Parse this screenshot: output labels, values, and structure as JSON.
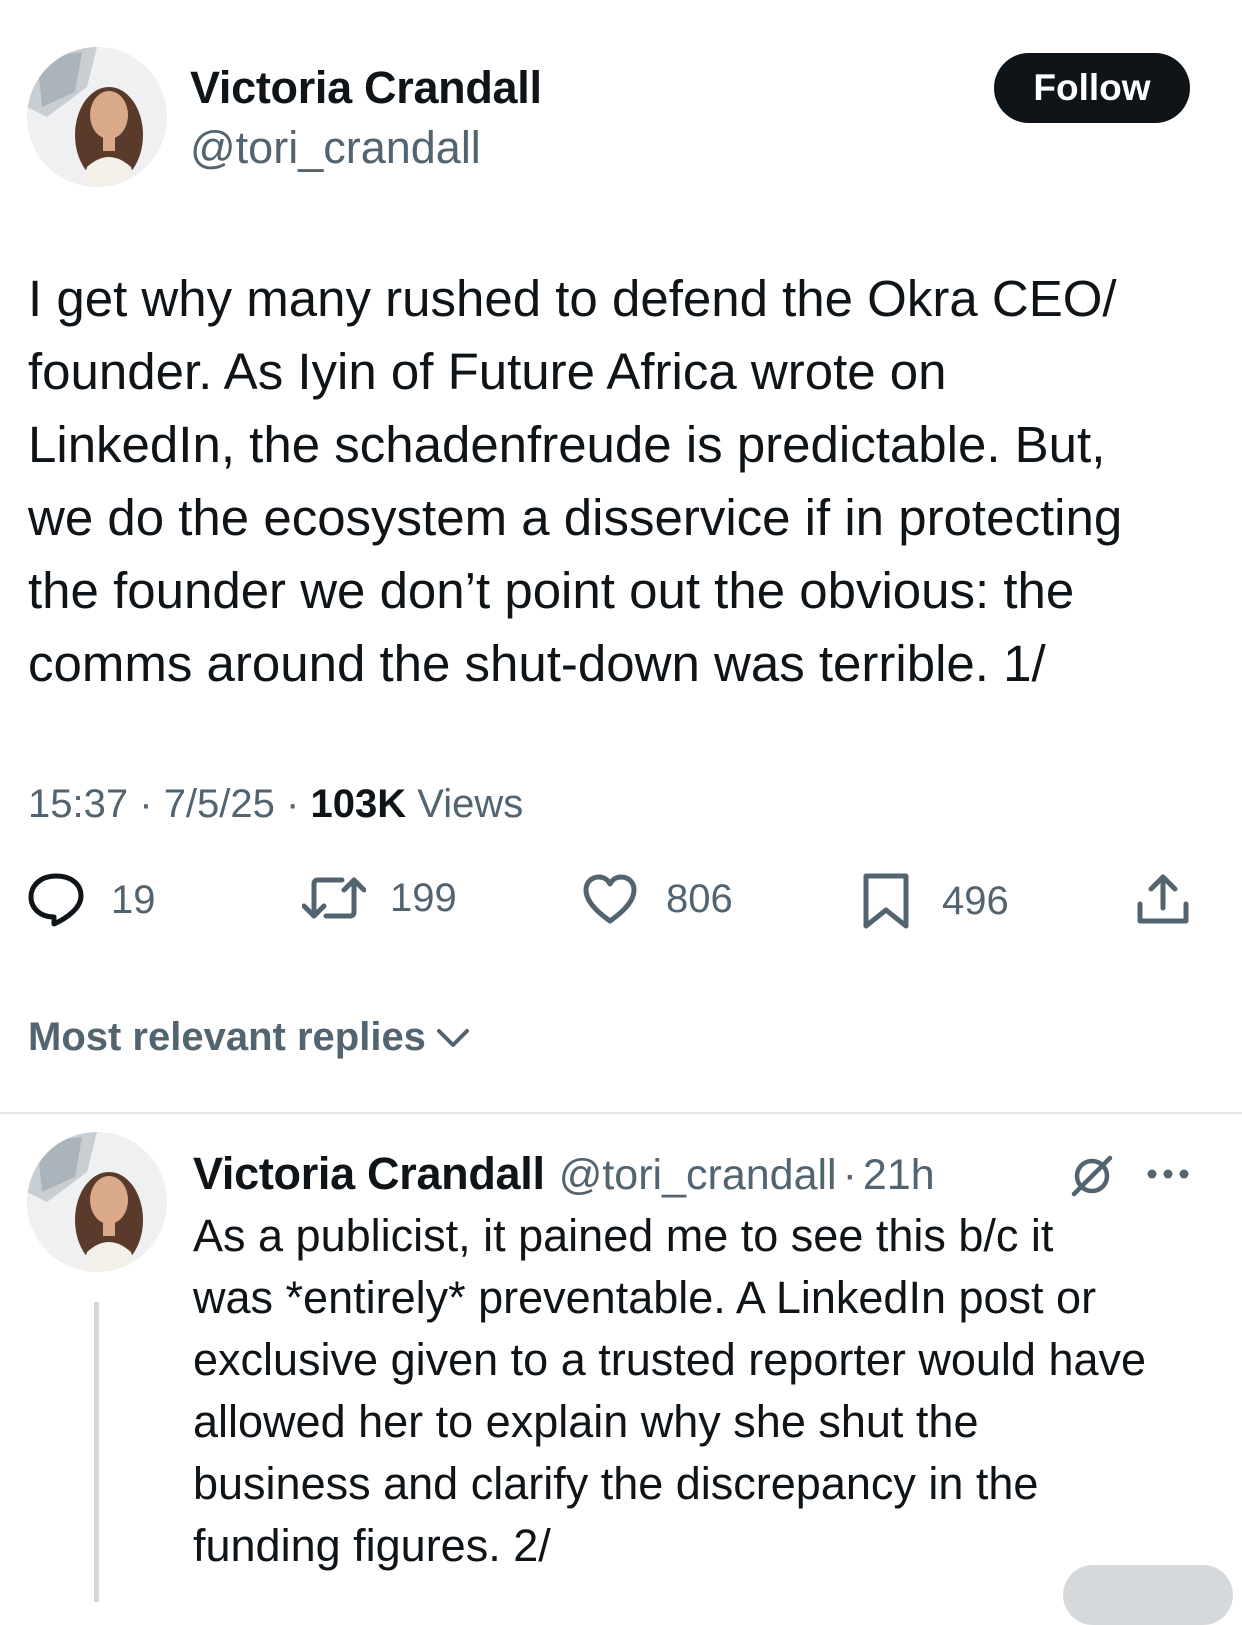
{
  "tweet": {
    "author": {
      "name": "Victoria Crandall",
      "handle": "@tori_crandall"
    },
    "follow_label": "Follow",
    "text": "I get why many rushed to defend the Okra CEO/\nfounder. As Iyin of Future Africa wrote on\nLinkedIn, the schadenfreude is predictable. But,\nwe do the ecosystem a disservice if in protecting\nthe founder we don’t point out the obvious: the\ncomms around the shut-down was terrible. 1/",
    "time": "15:37",
    "date": "7/5/25",
    "separator": "·",
    "views_count": "103K",
    "views_label": "Views",
    "stats": {
      "replies": "19",
      "reposts": "199",
      "likes": "806",
      "bookmarks": "496"
    }
  },
  "replies_sort": {
    "label": "Most relevant replies"
  },
  "reply": {
    "author": {
      "name": "Victoria Crandall",
      "handle": "@tori_crandall"
    },
    "separator": "·",
    "age": "21h",
    "text": "As a publicist, it pained me to see this b/c it\nwas *entirely* preventable. A LinkedIn post or\nexclusive given to a trusted reporter would have\nallowed her to explain why she shut the\nbusiness and clarify the discrepancy in the\nfunding figures. 2/"
  },
  "colors": {
    "text_primary": "#0f1419",
    "text_secondary": "#536471",
    "divider": "#e3e7ea",
    "follow_bg": "#0f1419",
    "follow_text": "#ffffff"
  },
  "icons": [
    "reply-icon",
    "repost-icon",
    "like-icon",
    "bookmark-icon",
    "share-icon",
    "chevron-down-icon",
    "grok-icon",
    "more-icon"
  ]
}
